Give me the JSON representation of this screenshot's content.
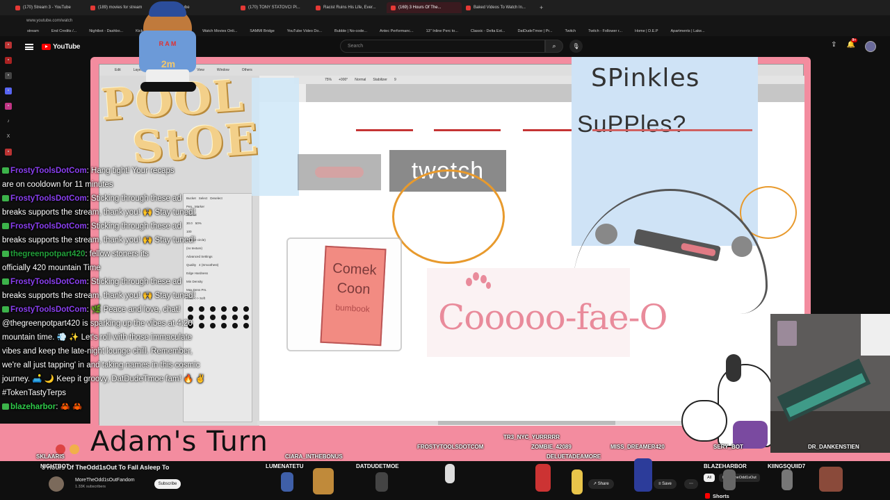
{
  "browser": {
    "tabs": [
      "(170) Stream 3 - YouTube",
      "(189) movies for stream",
      "YouTube",
      "(170) TONY STATOVCI Pl...",
      "Racist Ruins His Life, Ever...",
      "(169) 3 Hours Of The...",
      "Baked Videos To Watch In..."
    ],
    "active_tab": 5,
    "url": "www.youtube.com/watch",
    "bookmarks": [
      "stream",
      "End Credits /...",
      "Nightbot - Dashbo...",
      "Kick",
      "Online Head Shop...",
      "Watch Movies Onli...",
      "SAMMI Bridge",
      "YouTube Video Do...",
      "Bubble | No-code...",
      "Antec Performanc...",
      "13\" Inline Perc to...",
      "Classic - Delta Ext...",
      "DatDudeTmoe | Pr...",
      "Twitch",
      "Twitch - Follower r...",
      "Home | D.E.P",
      "Apartments | Lake..."
    ]
  },
  "youtube": {
    "logo": "YouTube",
    "search_placeholder": "Search",
    "notif_count": "9+",
    "video_title": "3 Hours Of TheOdd1sOut To Fall Asleep To",
    "channel_name": "MoreTheOdd1sOutFandom",
    "channel_subs": "1.33K subscribers",
    "subscribe_label": "Subscribe",
    "share_label": "Share",
    "save_label": "Save",
    "chip_all": "All",
    "chip_from": "From TheOdd1sOut",
    "shorts_label": "Shorts"
  },
  "stream": {
    "app_menu": [
      "Edit",
      "Layer",
      "Select",
      "Filter",
      "View",
      "Window",
      "Others"
    ],
    "zoom": "75%",
    "angle": "+000°",
    "blend": "Normal",
    "stabilizer_label": "Stabilizer",
    "stabilizer_value": "9",
    "pool_title_1": "POOL",
    "pool_title_2": "StOE",
    "spinkles": "SPinkles",
    "supplies": "SuPPles?",
    "twotch": "twotch",
    "comek_1": "Comek",
    "comek_2": "Coon",
    "comek_3": "bumbook",
    "chik": "Cooooo-fae-O",
    "adams_turn": "Adam's Turn",
    "bear_counter": "2m",
    "bear_name": "R A M",
    "props": {
      "quality_label": "Quality",
      "quality_value": "4 (Smoothest)",
      "edge_label": "Edge Hardness",
      "density_label": "Min Density",
      "size_label": "Max Dens Prs.",
      "hard_soft": "Hard <-> Soft",
      "normal": "Normal",
      "simple_circle": "(simple circle)",
      "no_texture": "(no texture)",
      "advanced": "Advanced Settings",
      "value_100": "100",
      "value_50": "50%",
      "value_30": "30.0",
      "tools": [
        "Bucket",
        "Select",
        "Deselect",
        "Pen",
        "Marker"
      ]
    },
    "chat": [
      {
        "name": "FrostyToolsDotCom",
        "text": ": Hang tight! Your recaps"
      },
      {
        "name": "",
        "text": "are on cooldown for 11 minutes"
      },
      {
        "name": "FrostyToolsDotCom",
        "text": ": Sticking through these ad"
      },
      {
        "name": "",
        "text": "breaks supports the stream, thank you! 🙌 Stay tuned!"
      },
      {
        "name": "FrostyToolsDotCom",
        "text": ": Sticking through these ad"
      },
      {
        "name": "",
        "text": "breaks supports the stream, thank you! 🙌 Stay tuned!"
      },
      {
        "name": "thegreenpotpart420",
        "text": ": fellow stoners its"
      },
      {
        "name": "",
        "text": "officially 420 mountain Time"
      },
      {
        "name": "FrostyToolsDotCom",
        "text": ": Sticking through these ad"
      },
      {
        "name": "",
        "text": "breaks supports the stream, thank you! 🙌 Stay tuned!"
      },
      {
        "name": "FrostyToolsDotCom",
        "text": ": 🌿 Peace and love, chat!"
      },
      {
        "name": "",
        "text": "@thegreenpotpart420 is sparking up the vibes at 4:20"
      },
      {
        "name": "",
        "text": "mountain time. 💨 ✨ Let's roll with those immaculate"
      },
      {
        "name": "",
        "text": "vibes and keep the late-night lounge chill. Remember,"
      },
      {
        "name": "",
        "text": "we're all just tapping' in and taking names in this cosmic"
      },
      {
        "name": "",
        "text": "journey. 🛋️ 🌙 Keep it groovy, DatDudeTmoe fam! 🔥 ✌️"
      },
      {
        "name": "",
        "text": "#TokenTastyTerps"
      },
      {
        "name": "blazeharbor",
        "text": ": 🦀 🦀"
      }
    ],
    "nicknames": [
      {
        "text": "SKLAARIS"
      },
      {
        "text": "NIGHTBOT"
      },
      {
        "text": "CIARA_INTHEBONUS"
      },
      {
        "text": "LUMENATETU"
      },
      {
        "text": "DATDUDETMOE"
      },
      {
        "text": "FROSTYTOOLSDOTCOM"
      },
      {
        "text": "TR3_NYC_YURRRRR"
      },
      {
        "text": "ZOMBIE_42089"
      },
      {
        "text": "DELUETADEAMORE"
      },
      {
        "text": "MISS_DREAMER420"
      },
      {
        "text": "SERY_BOT"
      },
      {
        "text": "DR_DANKENSTIEN"
      },
      {
        "text": "BLAZEHARBOR"
      },
      {
        "text": "KIINGSQUIID7"
      }
    ]
  },
  "colors": {
    "overlay_pink": "#f38c9f",
    "chat_name_purple": "#8a3ff0",
    "chat_name_green": "#22a03a",
    "yt_red": "#ff0000"
  }
}
